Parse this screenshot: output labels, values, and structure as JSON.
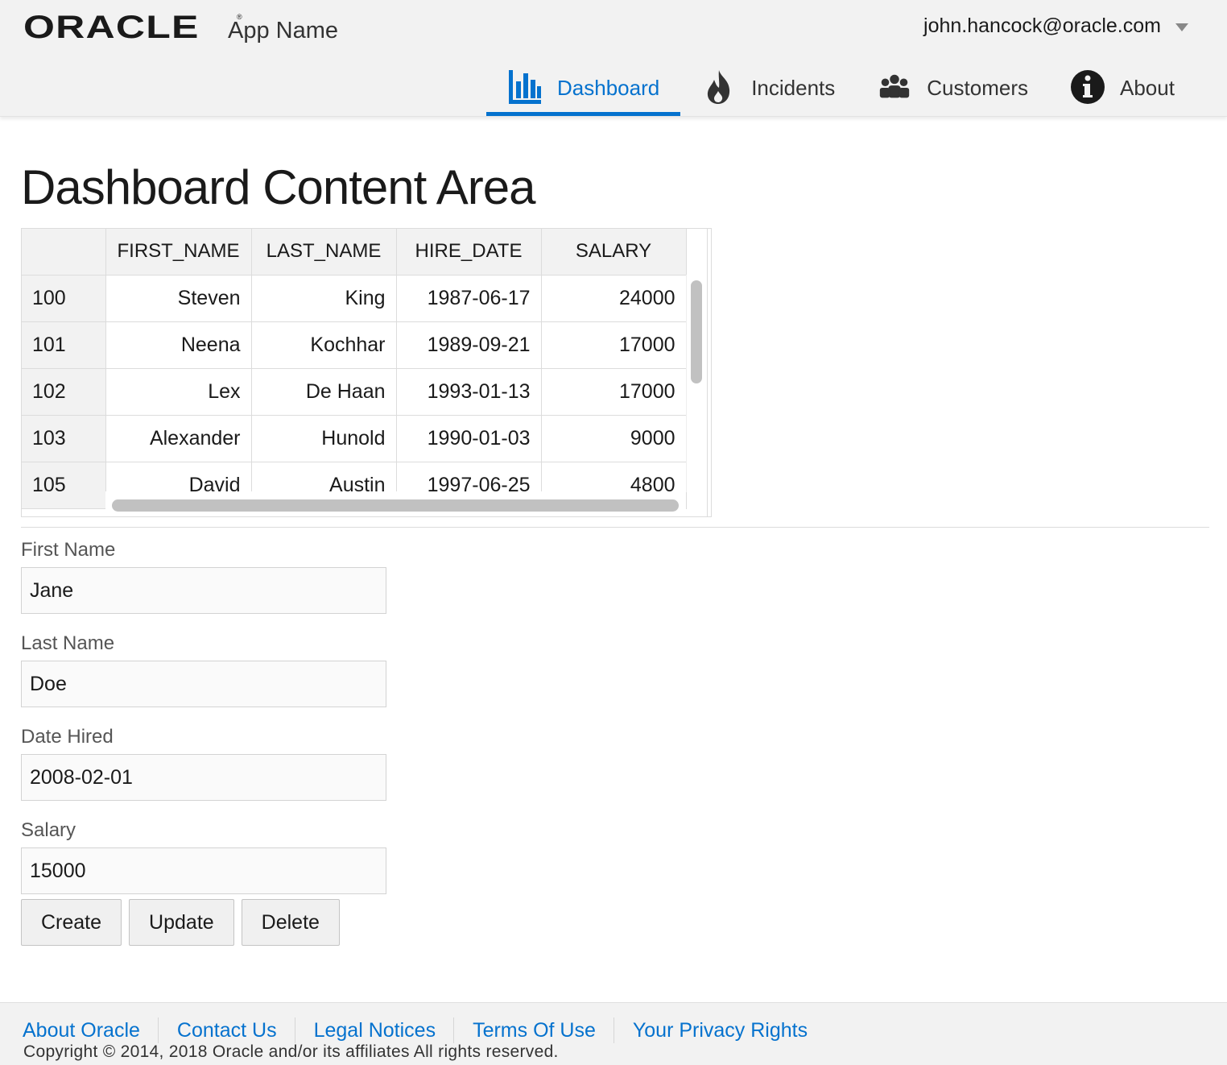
{
  "header": {
    "logo_text": "ORACLE",
    "logo_registered": "®",
    "app_name": "App Name",
    "user_email": "john.hancock@oracle.com",
    "nav": [
      {
        "label": "Dashboard",
        "icon": "bar-chart-icon",
        "active": true
      },
      {
        "label": "Incidents",
        "icon": "fire-icon",
        "active": false
      },
      {
        "label": "Customers",
        "icon": "people-icon",
        "active": false
      },
      {
        "label": "About",
        "icon": "info-icon",
        "active": false
      }
    ]
  },
  "main": {
    "title": "Dashboard Content Area",
    "table": {
      "columns": [
        "",
        "FIRST_NAME",
        "LAST_NAME",
        "HIRE_DATE",
        "SALARY"
      ],
      "rows": [
        {
          "id": "100",
          "first_name": "Steven",
          "last_name": "King",
          "hire_date": "1987-06-17",
          "salary": "24000"
        },
        {
          "id": "101",
          "first_name": "Neena",
          "last_name": "Kochhar",
          "hire_date": "1989-09-21",
          "salary": "17000"
        },
        {
          "id": "102",
          "first_name": "Lex",
          "last_name": "De Haan",
          "hire_date": "1993-01-13",
          "salary": "17000"
        },
        {
          "id": "103",
          "first_name": "Alexander",
          "last_name": "Hunold",
          "hire_date": "1990-01-03",
          "salary": "9000"
        },
        {
          "id": "105",
          "first_name": "David",
          "last_name": "Austin",
          "hire_date": "1997-06-25",
          "salary": "4800"
        }
      ]
    },
    "form": {
      "first_name_label": "First Name",
      "first_name_value": "Jane",
      "last_name_label": "Last Name",
      "last_name_value": "Doe",
      "date_hired_label": "Date Hired",
      "date_hired_value": "2008-02-01",
      "salary_label": "Salary",
      "salary_value": "15000"
    },
    "buttons": {
      "create": "Create",
      "update": "Update",
      "delete": "Delete"
    }
  },
  "footer": {
    "links": [
      "About Oracle",
      "Contact Us",
      "Legal Notices",
      "Terms Of Use",
      "Your Privacy Rights"
    ],
    "copyright": "Copyright © 2014, 2018 Oracle and/or its affiliates All rights reserved."
  },
  "colors": {
    "accent": "#0572ce",
    "header_bg": "#f2f2f2",
    "text": "#1a1a1a"
  }
}
